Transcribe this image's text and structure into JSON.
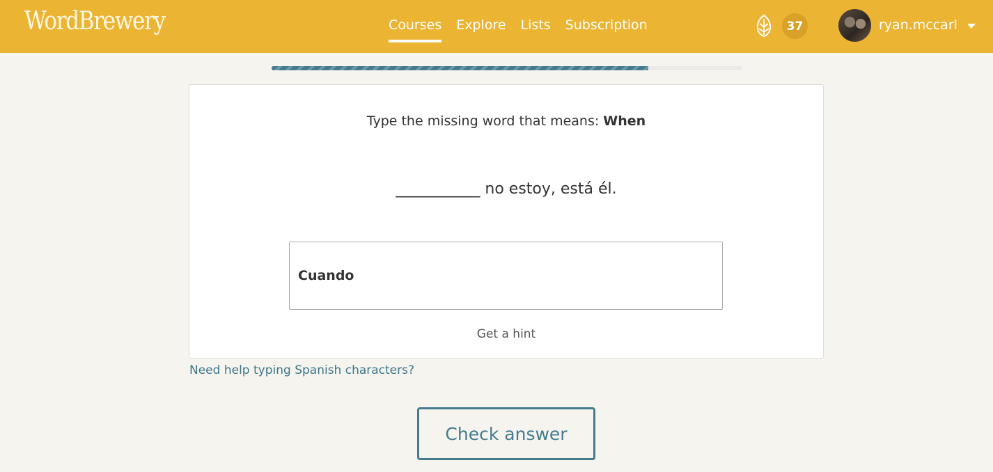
{
  "header": {
    "logo": "WordBrewery",
    "nav": [
      "Courses",
      "Explore",
      "Lists",
      "Subscription"
    ],
    "active_nav": "Courses",
    "points": "37",
    "username": "ryan.mccarl",
    "icons": {
      "points": "hop-icon",
      "menu": "chevron-down-icon"
    }
  },
  "progress": {
    "fraction": 0.8
  },
  "exercise": {
    "prompt_prefix": "Type the missing word that means: ",
    "prompt_word": "When",
    "blank": "___________",
    "sentence_rest": " no estoy, está él.",
    "answer_value": "Cuando",
    "hint_label": "Get a hint"
  },
  "help_link": "Need help typing Spanish characters?",
  "check_button": "Check answer",
  "colors": {
    "header_bg": "#ecb433",
    "accent": "#457b8d",
    "page_bg": "#f5f4ef"
  }
}
